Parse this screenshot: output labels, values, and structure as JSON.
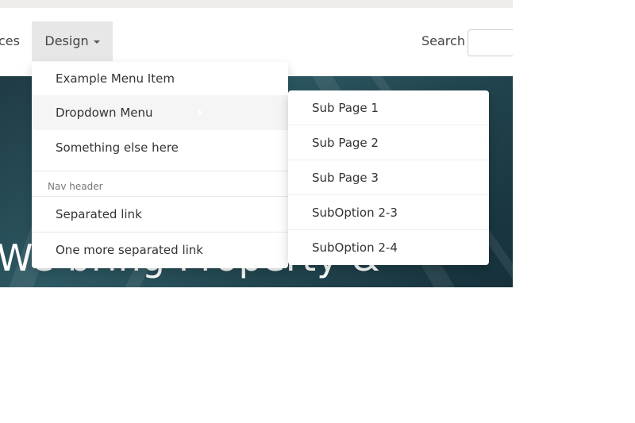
{
  "nav": {
    "partial_label": "ces",
    "design_label": "Design",
    "search_label": "Search"
  },
  "hero": {
    "title": "We bring Property &"
  },
  "dropdown": {
    "items": [
      "Example Menu Item",
      "Dropdown Menu",
      "Something else here"
    ],
    "header": "Nav header",
    "separated": [
      "Separated link",
      "One more separated link"
    ]
  },
  "submenu": {
    "items": [
      "Sub Page 1",
      "Sub Page 2",
      "Sub Page 3",
      "SubOption 2-3",
      "SubOption 2-4"
    ]
  }
}
